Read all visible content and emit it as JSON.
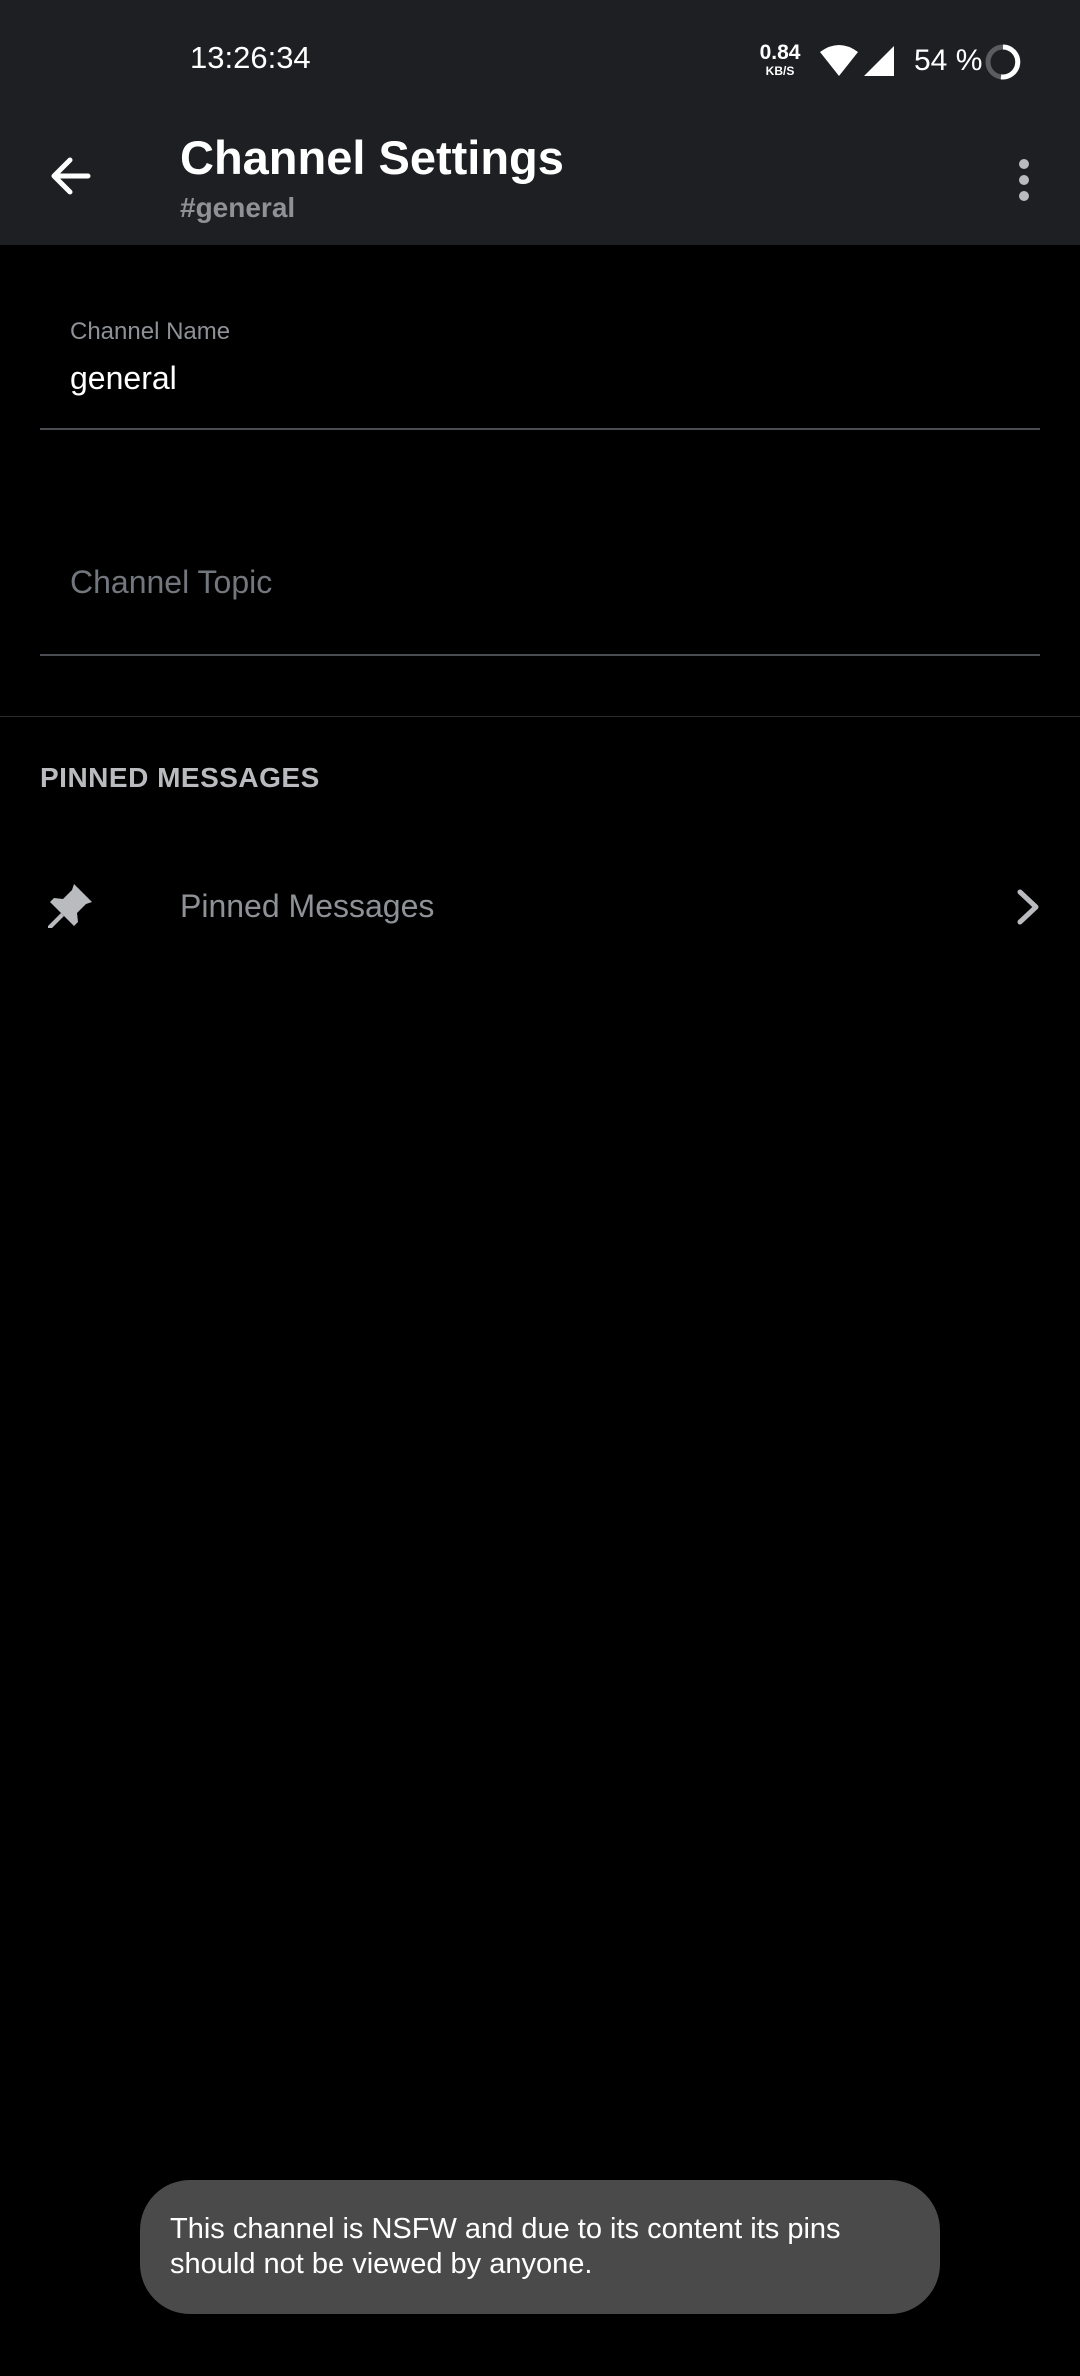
{
  "status_bar": {
    "time": "13:26:34",
    "net_speed_value": "0.84",
    "net_speed_unit": "KB/S",
    "battery_percent": "54 %",
    "icons": [
      "wifi-icon",
      "signal-icon",
      "battery-ring-icon"
    ]
  },
  "app_bar": {
    "title": "Channel Settings",
    "subtitle": "#general",
    "back_icon": "arrow-left-icon",
    "menu_icon": "more-vertical-icon"
  },
  "form": {
    "channel_name": {
      "label": "Channel Name",
      "value": "general"
    },
    "channel_topic": {
      "placeholder": "Channel Topic",
      "value": ""
    }
  },
  "pinned": {
    "section_header": "PINNED MESSAGES",
    "row_label": "Pinned Messages",
    "icon": "pin-icon",
    "chevron_icon": "chevron-right-icon"
  },
  "toast": {
    "text": "This channel is NSFW and due to its content its pins should not be viewed by anyone."
  },
  "colors": {
    "bar_background": "#1e1f22",
    "page_background": "#000000",
    "muted_text": "#8e9297",
    "toast_background": "#4a4a4a"
  }
}
